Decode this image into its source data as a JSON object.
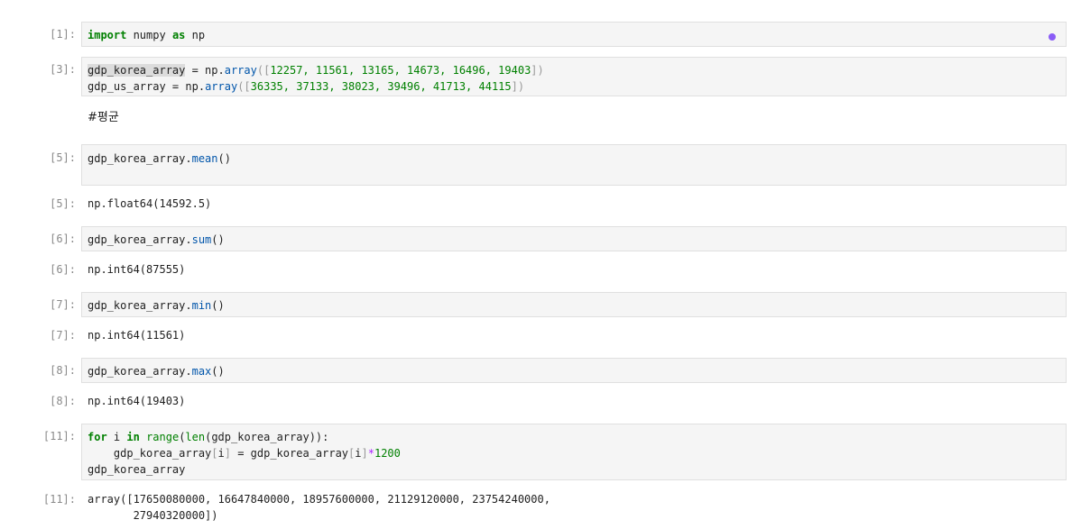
{
  "cells": [
    {
      "prompt": "[1]:",
      "code": {
        "kw_import": "import",
        "module": " numpy ",
        "kw_as": "as",
        "alias": " np"
      }
    },
    {
      "prompt": "[3]:",
      "code": {
        "line1": {
          "var": "gdp_korea_array",
          "assign": " = np.",
          "fn": "array",
          "open": "([",
          "values": "12257, 11561, 13165, 14673, 16496, 19403",
          "close": "])"
        },
        "line2": {
          "var": "gdp_us_array",
          "assign": " = np.",
          "fn": "array",
          "open": "([",
          "values": "36335, 37133, 38023, 39496, 41713, 44115",
          "close": "])"
        }
      }
    },
    {
      "markdown": "#평균"
    },
    {
      "prompt": "[5]:",
      "code": {
        "obj": "gdp_korea_array.",
        "method": "mean",
        "call": "()"
      },
      "output_prompt": "[5]:",
      "output": "np.float64(14592.5)"
    },
    {
      "prompt": "[6]:",
      "code": {
        "obj": "gdp_korea_array.",
        "method": "sum",
        "call": "()"
      },
      "output_prompt": "[6]:",
      "output": "np.int64(87555)"
    },
    {
      "prompt": "[7]:",
      "code": {
        "obj": "gdp_korea_array.",
        "method": "min",
        "call": "()"
      },
      "output_prompt": "[7]:",
      "output": "np.int64(11561)"
    },
    {
      "prompt": "[8]:",
      "code": {
        "obj": "gdp_korea_array.",
        "method": "max",
        "call": "()"
      },
      "output_prompt": "[8]:",
      "output": "np.int64(19403)"
    },
    {
      "prompt": "[11]:",
      "code": {
        "kw_for": "for",
        "loop_var": " i ",
        "kw_in": "in",
        "fn_range": "range",
        "p1": "(",
        "fn_len": "len",
        "p2": "(gdp_korea_array)):",
        "indent": "    gdp_korea_array",
        "idx_open": "[",
        "idx_var": "i",
        "idx_close": "]",
        "assign": " = gdp_korea_array",
        "idx2_open": "[",
        "idx2_var": "i",
        "idx2_close": "]",
        "op_mul": "*",
        "num": "1200",
        "line3": "gdp_korea_array"
      },
      "output_prompt": "[11]:",
      "output_line1": "array([17650080000, 16647840000, 18957600000, 21129120000, 23754240000,",
      "output_line2": "       27940320000])"
    }
  ],
  "colors": {
    "keyword": "#008000",
    "builtin": "#0055aa",
    "number": "#008000",
    "operator": "#aa22ff",
    "status_dot": "#8a5cf6"
  }
}
